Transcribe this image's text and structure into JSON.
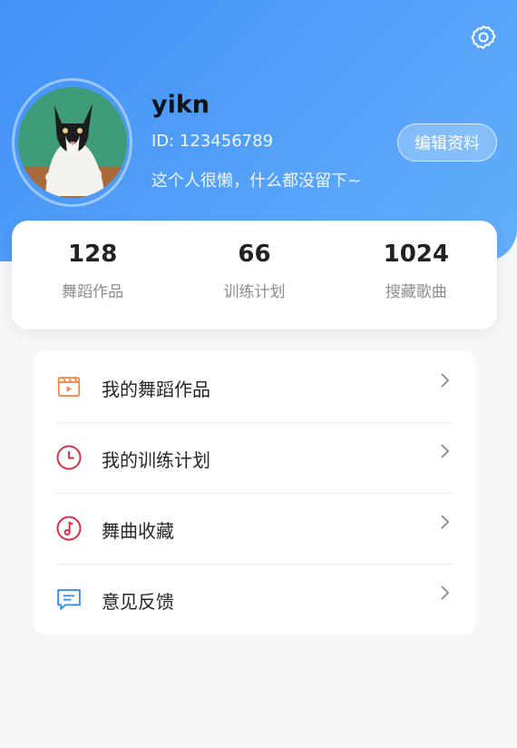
{
  "profile": {
    "username": "yikn",
    "user_id": "ID: 123456789",
    "bio": "这个人很懒，什么都没留下~",
    "edit_label": "编辑资料"
  },
  "stats": [
    {
      "value": "128",
      "label": "舞蹈作品"
    },
    {
      "value": "66",
      "label": "训练计划"
    },
    {
      "value": "1024",
      "label": "搜藏歌曲"
    }
  ],
  "menu": [
    {
      "label": "我的舞蹈作品",
      "icon": "video-icon",
      "color": "#f08a4b"
    },
    {
      "label": "我的训练计划",
      "icon": "clock-icon",
      "color": "#d9314a"
    },
    {
      "label": "舞曲收藏",
      "icon": "music-note-icon",
      "color": "#d9314a"
    },
    {
      "label": "意见反馈",
      "icon": "feedback-icon",
      "color": "#3d8bf2"
    }
  ],
  "colors": {
    "header_start": "#4191f7",
    "header_end": "#63aefb",
    "page_bg": "#f5f6f8"
  }
}
